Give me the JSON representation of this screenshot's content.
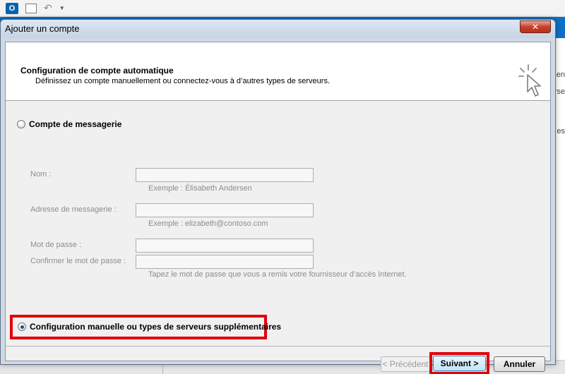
{
  "dialog": {
    "title": "Ajouter un compte",
    "close_label": "✕"
  },
  "header": {
    "title": "Configuration de compte automatique",
    "subtitle": "Définissez un compte manuellement ou connectez-vous à d’autres types de serveurs."
  },
  "options": {
    "email_account": {
      "label": "Compte de messagerie",
      "selected": false
    },
    "manual_config": {
      "label": "Configuration manuelle ou types de serveurs supplémentaires",
      "selected": true
    }
  },
  "form": {
    "name": {
      "label": "Nom :",
      "value": "",
      "hint": "Exemple : Élisabeth Andersen"
    },
    "email": {
      "label": "Adresse de messagerie :",
      "value": "",
      "hint": "Exemple : elizabeth@contoso.com"
    },
    "password": {
      "label": "Mot de passe :",
      "value": ""
    },
    "confirm_password": {
      "label": "Confirmer le mot de passe :",
      "value": "",
      "hint": "Tapez le mot de passe que vous a remis votre fournisseur d’accès Internet."
    }
  },
  "buttons": {
    "back": "< Précédent",
    "next": "Suivant >",
    "cancel": "Annuler"
  },
  "background": {
    "qat_logo": "O",
    "right_fragment_1": "en",
    "right_fragment_2": "rse",
    "right_fragment_3": "es"
  },
  "colors": {
    "highlight": "#e0000a",
    "ribbon": "#0f6fc6",
    "close_button": "#c7402b"
  },
  "icons": {
    "wizard": "cursor-sparkle-icon",
    "outlook": "outlook-logo-icon",
    "undo": "undo-icon"
  }
}
